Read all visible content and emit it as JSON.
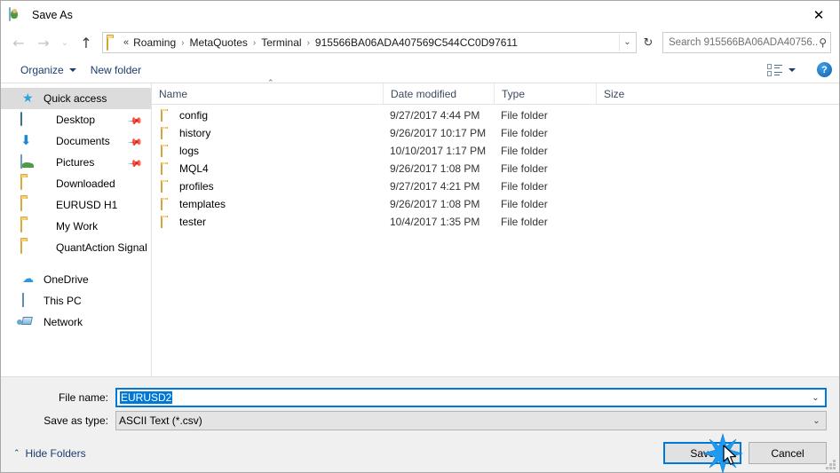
{
  "window": {
    "title": "Save As",
    "app_icon": "save-as-icon",
    "close_label": "✕"
  },
  "nav": {
    "back_icon": "←",
    "forward_icon": "→",
    "recent_icon": "⌄",
    "up_icon": "↑",
    "refresh_icon": "↻",
    "dropdown_icon": "⌄",
    "breadcrumb_prefix": "«",
    "breadcrumb_separator": "›",
    "breadcrumbs": [
      "Roaming",
      "MetaQuotes",
      "Terminal",
      "915566BA06ADA407569C544CC0D97611"
    ]
  },
  "search": {
    "placeholder": "Search 915566BA06ADA40756...",
    "icon": "⚲"
  },
  "commandbar": {
    "organize_label": "Organize",
    "new_folder_label": "New folder",
    "view_icon": "view-list-icon",
    "help_label": "?"
  },
  "sidebar": {
    "items": [
      {
        "label": "Quick access",
        "icon": "star-icon",
        "level": "group",
        "selected": true,
        "pinned": false
      },
      {
        "label": "Desktop",
        "icon": "desktop-icon",
        "level": "child",
        "selected": false,
        "pinned": true
      },
      {
        "label": "Documents",
        "icon": "documents-icon",
        "level": "child",
        "selected": false,
        "pinned": true
      },
      {
        "label": "Pictures",
        "icon": "pictures-icon",
        "level": "child",
        "selected": false,
        "pinned": true
      },
      {
        "label": "Downloaded",
        "icon": "folder-icon",
        "level": "child",
        "selected": false,
        "pinned": false
      },
      {
        "label": "EURUSD H1",
        "icon": "folder-icon",
        "level": "child",
        "selected": false,
        "pinned": false
      },
      {
        "label": "My Work",
        "icon": "folder-icon",
        "level": "child",
        "selected": false,
        "pinned": false
      },
      {
        "label": "QuantAction Signal",
        "icon": "folder-icon",
        "level": "child",
        "selected": false,
        "pinned": false
      },
      {
        "label": "",
        "icon": "gap",
        "level": "gap",
        "selected": false,
        "pinned": false
      },
      {
        "label": "OneDrive",
        "icon": "cloud-icon",
        "level": "group",
        "selected": false,
        "pinned": false
      },
      {
        "label": "This PC",
        "icon": "pc-icon",
        "level": "group",
        "selected": false,
        "pinned": false
      },
      {
        "label": "Network",
        "icon": "network-icon",
        "level": "group",
        "selected": false,
        "pinned": false
      }
    ],
    "pin_glyph": "📌"
  },
  "filelist": {
    "columns": [
      "Name",
      "Date modified",
      "Type",
      "Size"
    ],
    "sort_indicator": "⌃",
    "rows": [
      {
        "name": "config",
        "date": "9/27/2017 4:44 PM",
        "type": "File folder",
        "size": ""
      },
      {
        "name": "history",
        "date": "9/26/2017 10:17 PM",
        "type": "File folder",
        "size": ""
      },
      {
        "name": "logs",
        "date": "10/10/2017 1:17 PM",
        "type": "File folder",
        "size": ""
      },
      {
        "name": "MQL4",
        "date": "9/26/2017 1:08 PM",
        "type": "File folder",
        "size": ""
      },
      {
        "name": "profiles",
        "date": "9/27/2017 4:21 PM",
        "type": "File folder",
        "size": ""
      },
      {
        "name": "templates",
        "date": "9/26/2017 1:08 PM",
        "type": "File folder",
        "size": ""
      },
      {
        "name": "tester",
        "date": "10/4/2017 1:35 PM",
        "type": "File folder",
        "size": ""
      }
    ]
  },
  "form": {
    "filename_label": "File name:",
    "filename_value": "EURUSD2",
    "filetype_label": "Save as type:",
    "filetype_value": "ASCII Text (*.csv)",
    "chevron": "⌄"
  },
  "footer": {
    "hide_folders_label": "Hide Folders",
    "hide_folders_chevron": "⌃",
    "save_label": "Save",
    "cancel_label": "Cancel"
  },
  "colors": {
    "accent": "#0078d7",
    "folder": "#fbd06f",
    "selection": "#dcdcdc",
    "link": "#1a3c6e"
  }
}
